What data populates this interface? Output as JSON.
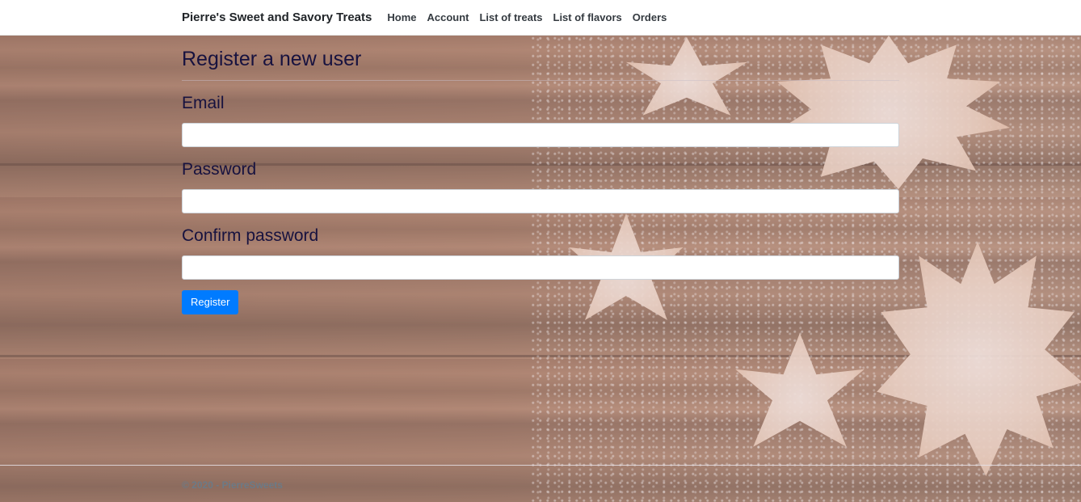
{
  "navbar": {
    "brand": "Pierre's Sweet and Savory Treats",
    "links": [
      {
        "label": "Home"
      },
      {
        "label": "Account"
      },
      {
        "label": "List of treats"
      },
      {
        "label": "List of flavors"
      },
      {
        "label": "Orders"
      }
    ]
  },
  "form": {
    "title": "Register a new user",
    "fields": [
      {
        "label": "Email",
        "value": ""
      },
      {
        "label": "Password",
        "value": ""
      },
      {
        "label": "Confirm password",
        "value": ""
      }
    ],
    "submit_label": "Register"
  },
  "footer": {
    "text": "© 2020 - PierreSweets"
  },
  "colors": {
    "primary_button": "#007bff",
    "heading_text": "#17123f",
    "footer_text": "#6c7a86"
  }
}
